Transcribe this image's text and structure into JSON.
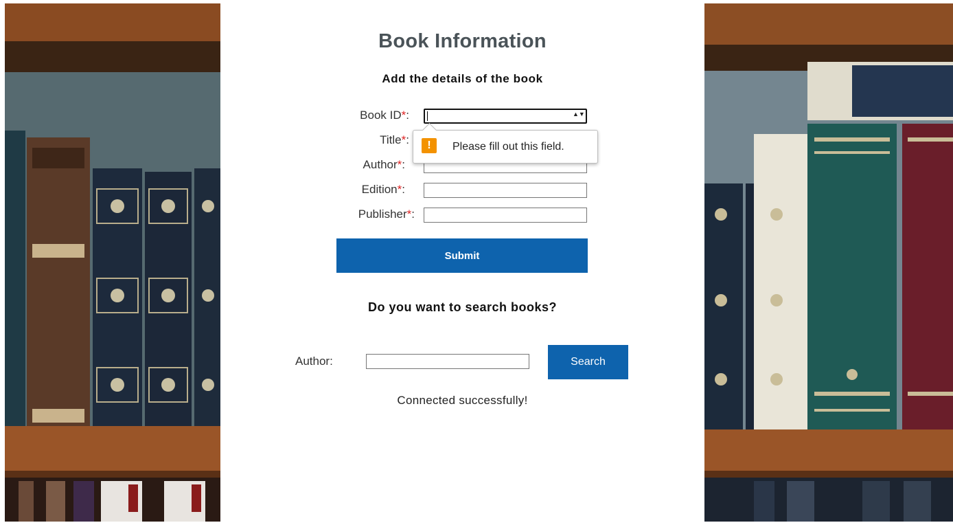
{
  "page": {
    "title": "Book Information",
    "subtitle": "Add the details of the book"
  },
  "form": {
    "required_marker": "*",
    "fields": [
      {
        "label": "Book ID",
        "value": "",
        "type": "number"
      },
      {
        "label": "Title",
        "value": "",
        "type": "text"
      },
      {
        "label": "Author",
        "value": "",
        "type": "text"
      },
      {
        "label": "Edition",
        "value": "",
        "type": "text"
      },
      {
        "label": "Publisher",
        "value": "",
        "type": "text"
      }
    ],
    "submit_label": "Submit",
    "spinner_glyph": "▲▼"
  },
  "validation": {
    "message": "Please fill out this field.",
    "icon": "!"
  },
  "search": {
    "heading": "Do you want to search books?",
    "author_label": "Author:",
    "author_value": "",
    "button_label": "Search"
  },
  "status": {
    "message": "Connected successfully!"
  },
  "colors": {
    "button": "#0e63ad",
    "title": "#4a5358",
    "required": "#dd2222",
    "warning": "#f39200"
  }
}
